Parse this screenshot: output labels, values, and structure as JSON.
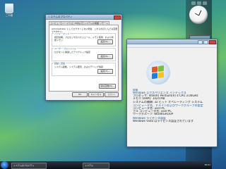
{
  "desktop": {
    "recycle_bin_label": "ごみ箱"
  },
  "taskbar": {
    "buttons": [
      "システムのプロパティ",
      "システム"
    ],
    "clock": "16:21"
  },
  "system_window": {
    "heading": "評価",
    "rows": [
      "Windows エクスペリエンス インデックス",
      "プロセッサ: Intel(R) Pentium(R) 4 CPU 3.00GHz",
      "メモリ (RAM): 1024 MB",
      "システムの種類: 32 ビット オペレーティング システム"
    ],
    "sections": [
      "コンピュータ名、ドメインおよびワークグループの設定",
      "Windows ライセンス認証"
    ],
    "section_rows": [
      "コンピュータ名: user-PC",
      "フル コンピュータ名: user-PC",
      "ワークグループ: WORKGROUP",
      "Windows Vista はライセンス認証されています"
    ]
  },
  "properties_dialog": {
    "title": "システムのプロパティ",
    "tabs": [
      "コンピュータ名",
      "ハードウェア",
      "詳細設定",
      "システムの保護",
      "リモート"
    ],
    "active_tab": "詳細設定",
    "note": "Administrator としてログオンしない場合、これらのほとんどは変更できません。",
    "groups": [
      {
        "title": "パフォーマンス",
        "desc": "視覚効果、プロセッサのスケジュール、メモリ使用、および仮想メモリ",
        "button": "設定(S)..."
      },
      {
        "title": "ユーザー プロファイル",
        "desc": "ログオンに関連したデスクトップ設定",
        "button": "設定(E)..."
      },
      {
        "title": "起動と回復",
        "desc": "システム起動、システム障害、およびデバッグ情報",
        "button": "設定(T)..."
      }
    ],
    "env_button": "環境変数(N)...",
    "ok_label": "OK",
    "cancel_label": "キャンセル",
    "apply_label": "適用(A)"
  }
}
